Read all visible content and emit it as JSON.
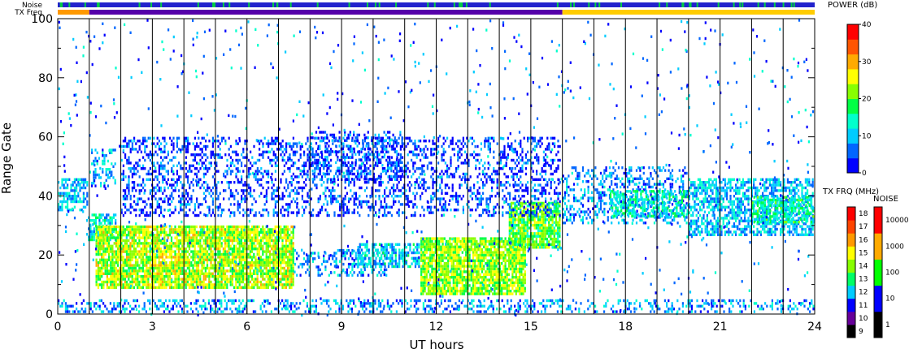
{
  "chart_data": {
    "type": "heatmap",
    "xlabel": "UT hours",
    "ylabel": "Range Gate",
    "xlim": [
      0,
      24
    ],
    "ylim": [
      0,
      100
    ],
    "x_ticks": [
      0,
      3,
      6,
      9,
      12,
      15,
      18,
      21,
      24
    ],
    "y_ticks": [
      0,
      20,
      40,
      60,
      80,
      100
    ],
    "scan_boundaries_ut": [
      1,
      2,
      3,
      4,
      5,
      6,
      7,
      8,
      9,
      10,
      11,
      12,
      13,
      14,
      15,
      16,
      17,
      18,
      19,
      20,
      21,
      22,
      23
    ],
    "top_strips": {
      "noise_label": "Noise",
      "txfreq_label": "TX Freq",
      "noise_color": "#2222cc",
      "txfreq_segments": [
        {
          "from": 0,
          "to": 1,
          "color": "#ff9900"
        },
        {
          "from": 1,
          "to": 16,
          "color": "#5500aa"
        },
        {
          "from": 16,
          "to": 24,
          "color": "#ffcc00"
        }
      ]
    },
    "power_colorbar": {
      "title": "POWER (dB)",
      "min": 0,
      "max": 40,
      "ticks": [
        0,
        10,
        20,
        30,
        40
      ],
      "colors": [
        "#0000ff",
        "#0066ff",
        "#00ccff",
        "#00ffcc",
        "#00ff44",
        "#88ff00",
        "#ffff00",
        "#ffaa00",
        "#ff5500",
        "#ff0000"
      ]
    },
    "txfreq_colorbar": {
      "title": "TX FRQ (MHz)",
      "ticks": [
        9,
        10,
        11,
        12,
        13,
        14,
        15,
        16,
        17,
        18
      ],
      "colors": [
        "#000000",
        "#660099",
        "#0000ff",
        "#00ccff",
        "#00ff66",
        "#88ff00",
        "#ffff00",
        "#ff9900",
        "#ff4400",
        "#ff0000"
      ]
    },
    "noise_colorbar": {
      "title": "NOISE",
      "ticks": [
        1,
        10,
        100,
        1000,
        10000
      ],
      "colors": [
        "#000000",
        "#0000ff",
        "#00ff00",
        "#ffaa00",
        "#ff0000"
      ]
    },
    "regions": [
      {
        "x": [
          0,
          1.0
        ],
        "y": [
          34,
          46
        ],
        "power": 10
      },
      {
        "x": [
          1.0,
          1.9
        ],
        "y": [
          42,
          56
        ],
        "power": 9
      },
      {
        "x": [
          0.9,
          1.9
        ],
        "y": [
          24,
          34
        ],
        "power": 12
      },
      {
        "x": [
          1.2,
          7.5
        ],
        "y": [
          8,
          30
        ],
        "power": 23
      },
      {
        "x": [
          7.5,
          10.5
        ],
        "y": [
          12,
          22
        ],
        "power": 8
      },
      {
        "x": [
          9.5,
          11.5
        ],
        "y": [
          15,
          24
        ],
        "power": 11
      },
      {
        "x": [
          11.5,
          14.9
        ],
        "y": [
          6,
          26
        ],
        "power": 22
      },
      {
        "x": [
          14.3,
          16.0
        ],
        "y": [
          22,
          38
        ],
        "power": 20
      },
      {
        "x": [
          16.0,
          20.0
        ],
        "y": [
          30,
          50
        ],
        "power": 8
      },
      {
        "x": [
          17.5,
          20.0
        ],
        "y": [
          32,
          42
        ],
        "power": 13
      },
      {
        "x": [
          20.0,
          24.0
        ],
        "y": [
          26,
          46
        ],
        "power": 10
      },
      {
        "x": [
          22.0,
          24.0
        ],
        "y": [
          30,
          40
        ],
        "power": 15
      },
      {
        "x": [
          2.0,
          16.0
        ],
        "y": [
          32,
          60
        ],
        "power": 4
      },
      {
        "x": [
          8.0,
          11.0
        ],
        "y": [
          45,
          62
        ],
        "power": 5
      },
      {
        "x": [
          0,
          24.0
        ],
        "y": [
          0,
          5
        ],
        "power": 8
      }
    ]
  }
}
